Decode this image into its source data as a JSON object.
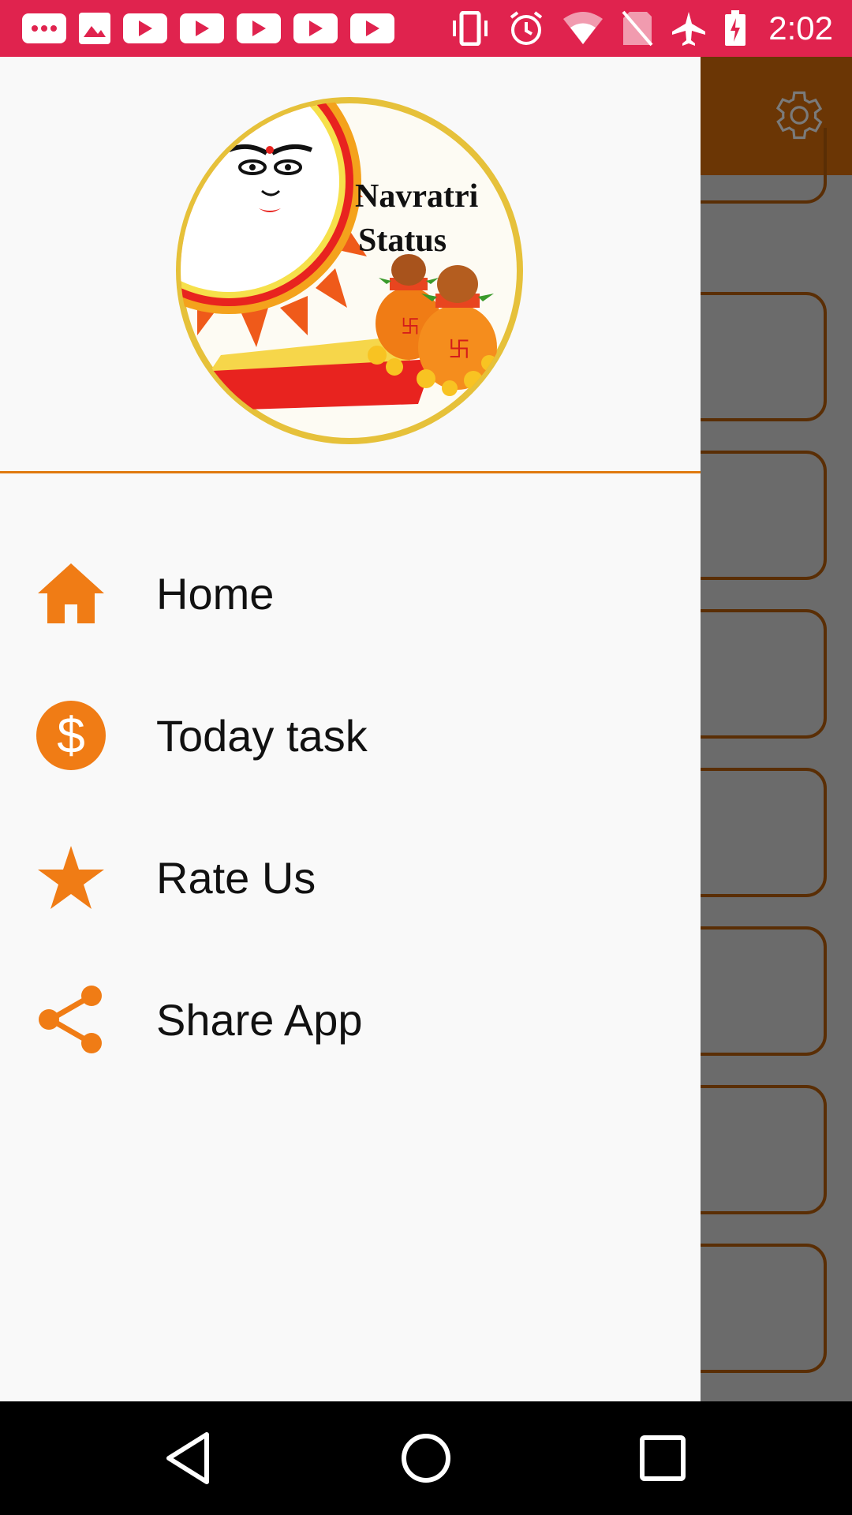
{
  "status_bar": {
    "time": "2:02",
    "left_icons": [
      "sms-icon",
      "image-icon",
      "youtube-icon",
      "youtube-icon",
      "youtube-icon",
      "youtube-icon",
      "youtube-icon"
    ],
    "right_icons": [
      "vibrate-icon",
      "alarm-icon",
      "wifi-icon",
      "no-sim-icon",
      "airplane-icon",
      "battery-charging-icon"
    ],
    "color": "#e0234e"
  },
  "drawer": {
    "logo_text_line1": "Navratri",
    "logo_text_line2": "Status",
    "accent_color": "#f07c15",
    "items": [
      {
        "label": "Home",
        "icon": "home-icon"
      },
      {
        "label": "Today task",
        "icon": "dollar-icon"
      },
      {
        "label": "Rate Us",
        "icon": "star-icon"
      },
      {
        "label": "Share App",
        "icon": "share-icon"
      }
    ]
  },
  "background_app": {
    "toolbar_color": "#6b3605",
    "settings_icon": "gear-icon"
  },
  "nav_bar": {
    "buttons": [
      "back-icon",
      "home-circle-icon",
      "recents-icon"
    ]
  }
}
